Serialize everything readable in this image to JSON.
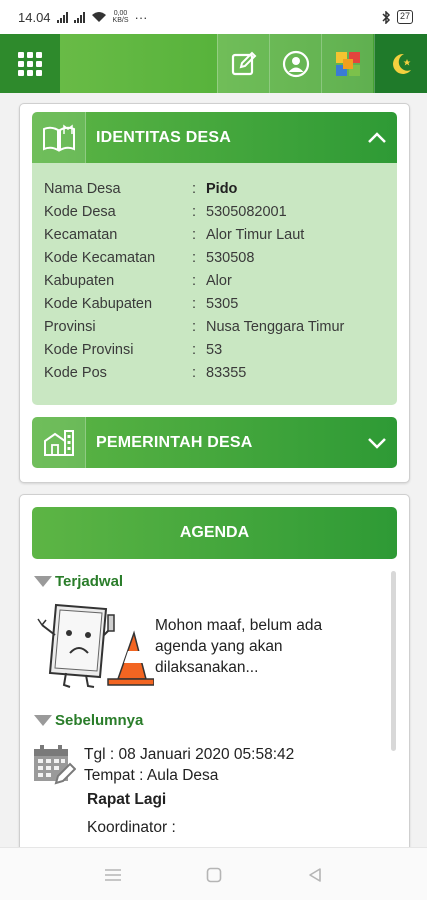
{
  "status_bar": {
    "time": "14.04",
    "net_speed_top": "0,00",
    "net_speed_bottom": "KB/S",
    "more": "···",
    "battery": "27"
  },
  "app_bar": {
    "icons": [
      "grid-menu-icon",
      "edit-icon",
      "user-icon",
      "tiles-icon",
      "moon-star-icon"
    ],
    "accent": "#2e8a2c"
  },
  "identitas": {
    "title": "IDENTITAS DESA",
    "rows": [
      {
        "label": "Nama Desa",
        "value": "Pido"
      },
      {
        "label": "Kode Desa",
        "value": "5305082001"
      },
      {
        "label": "Kecamatan",
        "value": "Alor Timur Laut"
      },
      {
        "label": "Kode Kecamatan",
        "value": "530508"
      },
      {
        "label": "Kabupaten",
        "value": "Alor"
      },
      {
        "label": "Kode Kabupaten",
        "value": "5305"
      },
      {
        "label": "Provinsi",
        "value": "Nusa Tenggara Timur"
      },
      {
        "label": "Kode Provinsi",
        "value": "53"
      },
      {
        "label": "Kode Pos",
        "value": "83355"
      }
    ],
    "colon": ":"
  },
  "pemerintah": {
    "title": "PEMERINTAH DESA"
  },
  "agenda": {
    "title": "AGENDA",
    "terjadwal": "Terjadwal",
    "empty_message": "Mohon maaf, belum ada agenda yang akan dilaksanakan...",
    "sebelumnya": "Sebelumnya",
    "item": {
      "tgl": "Tgl : 08 Januari 2020 05:58:42",
      "tempat": "Tempat : Aula Desa",
      "judul": "Rapat Lagi",
      "koordinator": "Koordinator :"
    }
  },
  "nav_bar": {
    "icons": [
      "menu-lines-icon",
      "home-square-icon",
      "back-triangle-icon"
    ]
  }
}
